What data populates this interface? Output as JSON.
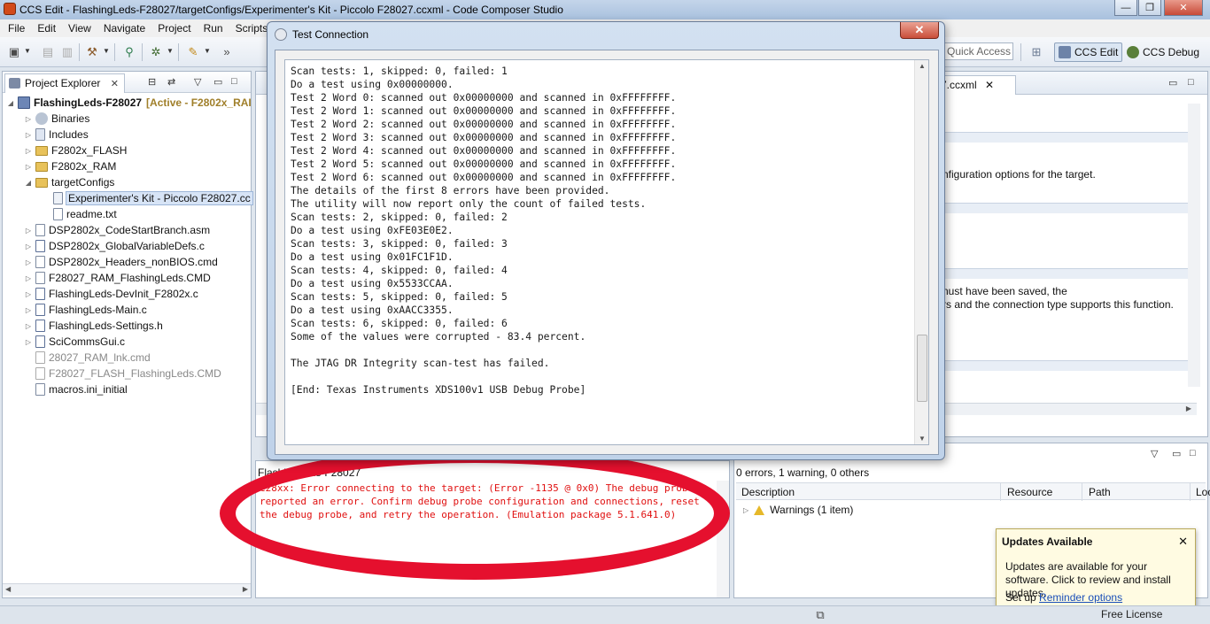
{
  "window": {
    "title": "CCS Edit - FlashingLeds-F28027/targetConfigs/Experimenter's Kit - Piccolo F28027.ccxml - Code Composer Studio",
    "controls": {
      "minimize": "—",
      "maximize": "❐",
      "close": "✕"
    }
  },
  "menu": [
    "File",
    "Edit",
    "View",
    "Navigate",
    "Project",
    "Run",
    "Scripts"
  ],
  "toolbar": {
    "quick_access_placeholder": "Quick Access",
    "perspectives": [
      {
        "label": "CCS Edit",
        "active": true
      },
      {
        "label": "CCS Debug",
        "active": false
      }
    ]
  },
  "project_explorer": {
    "title": "Project Explorer",
    "close_glyph": "✕",
    "items": [
      {
        "label": "FlashingLeds-F28027",
        "suffix": "[Active - F2802x_RAI",
        "icon": "project-icon",
        "depth": 0,
        "expanded": true
      },
      {
        "label": "Binaries",
        "icon": "binaries-icon",
        "depth": 1,
        "expanded": false
      },
      {
        "label": "Includes",
        "icon": "includes-icon",
        "depth": 1,
        "expanded": false
      },
      {
        "label": "F2802x_FLASH",
        "icon": "folder-icon",
        "depth": 1,
        "expanded": false
      },
      {
        "label": "F2802x_RAM",
        "icon": "folder-icon",
        "depth": 1,
        "expanded": false
      },
      {
        "label": "targetConfigs",
        "icon": "folder-icon",
        "depth": 1,
        "expanded": true
      },
      {
        "label": "Experimenter's Kit - Piccolo F28027.cc",
        "icon": "ccxml-file-icon",
        "depth": 2,
        "selected": true
      },
      {
        "label": "readme.txt",
        "icon": "text-file-icon",
        "depth": 2
      },
      {
        "label": "DSP2802x_CodeStartBranch.asm",
        "icon": "asm-file-icon",
        "depth": 1,
        "expanded": false
      },
      {
        "label": "DSP2802x_GlobalVariableDefs.c",
        "icon": "c-file-icon",
        "depth": 1,
        "expanded": false
      },
      {
        "label": "DSP2802x_Headers_nonBIOS.cmd",
        "icon": "cmd-file-icon",
        "depth": 1,
        "expanded": false
      },
      {
        "label": "F28027_RAM_FlashingLeds.CMD",
        "icon": "cmd-file-icon",
        "depth": 1,
        "expanded": false
      },
      {
        "label": "FlashingLeds-DevInit_F2802x.c",
        "icon": "c-file-icon",
        "depth": 1,
        "expanded": false
      },
      {
        "label": "FlashingLeds-Main.c",
        "icon": "c-file-icon",
        "depth": 1,
        "expanded": false
      },
      {
        "label": "FlashingLeds-Settings.h",
        "icon": "h-file-icon",
        "depth": 1,
        "expanded": false
      },
      {
        "label": "SciCommsGui.c",
        "icon": "c-file-icon",
        "depth": 1,
        "expanded": false
      },
      {
        "label": "28027_RAM_lnk.cmd",
        "icon": "cmd-file-icon",
        "depth": 1,
        "excluded": true
      },
      {
        "label": "F28027_FLASH_FlashingLeds.CMD",
        "icon": "cmd-file-icon",
        "depth": 1,
        "excluded": true
      },
      {
        "label": "macros.ini_initial",
        "icon": "text-file-icon",
        "depth": 1
      }
    ]
  },
  "editor": {
    "tab_label": "7.ccxml",
    "close_glyph": "✕",
    "fragments": [
      "nfiguration options for the target.",
      "nust have been saved, the",
      "rs and the connection type supports this function."
    ]
  },
  "dialog": {
    "title": "Test Connection",
    "close_glyph": "✕",
    "output_lines": [
      "Scan tests: 1, skipped: 0, failed: 1",
      "Do a test using 0x00000000.",
      "Test 2 Word 0: scanned out 0x00000000 and scanned in 0xFFFFFFFF.",
      "Test 2 Word 1: scanned out 0x00000000 and scanned in 0xFFFFFFFF.",
      "Test 2 Word 2: scanned out 0x00000000 and scanned in 0xFFFFFFFF.",
      "Test 2 Word 3: scanned out 0x00000000 and scanned in 0xFFFFFFFF.",
      "Test 2 Word 4: scanned out 0x00000000 and scanned in 0xFFFFFFFF.",
      "Test 2 Word 5: scanned out 0x00000000 and scanned in 0xFFFFFFFF.",
      "Test 2 Word 6: scanned out 0x00000000 and scanned in 0xFFFFFFFF.",
      "The details of the first 8 errors have been provided.",
      "The utility will now report only the count of failed tests.",
      "Scan tests: 2, skipped: 0, failed: 2",
      "Do a test using 0xFE03E0E2.",
      "Scan tests: 3, skipped: 0, failed: 3",
      "Do a test using 0x01FC1F1D.",
      "Scan tests: 4, skipped: 0, failed: 4",
      "Do a test using 0x5533CCAA.",
      "Scan tests: 5, skipped: 0, failed: 5",
      "Do a test using 0xAACC3355.",
      "Scan tests: 6, skipped: 0, failed: 6",
      "Some of the values were corrupted - 83.4 percent.",
      "",
      "The JTAG DR Integrity scan-test has failed.",
      "",
      "[End: Texas Instruments XDS100v1 USB Debug Probe]"
    ]
  },
  "console": {
    "title": "FlashingLeds-F28027",
    "error_text": "C28xx: Error connecting to the target: (Error -1135 @ 0x0) The debug probe reported an error. Confirm debug probe configuration and connections, reset the debug probe, and retry the operation. (Emulation package 5.1.641.0)"
  },
  "problems": {
    "summary": "0 errors, 1 warning, 0 others",
    "columns": [
      "Description",
      "Resource",
      "Path",
      "Loc"
    ],
    "rows": [
      {
        "label": "Warnings (1 item)"
      }
    ]
  },
  "updates_popup": {
    "title": "Updates Available",
    "close_glyph": "✕",
    "body": "Updates are available for your software. Click to review and install updates.",
    "setup_prefix": "Set up",
    "setup_link": "Reminder options"
  },
  "statusbar": {
    "license": "Free License"
  },
  "colors": {
    "error_text": "#e01010",
    "annotation_ring": "#e5102e",
    "active_project": "#a07f2a"
  }
}
